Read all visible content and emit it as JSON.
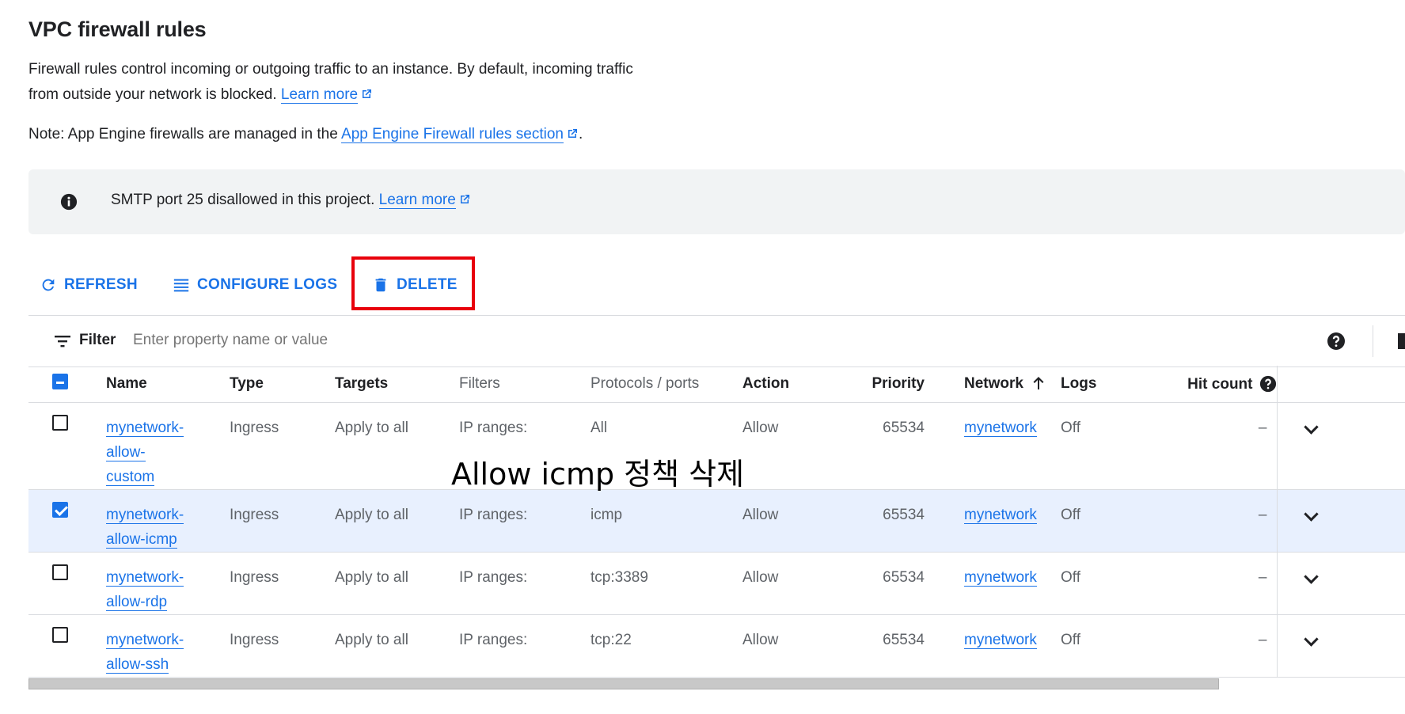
{
  "page": {
    "title": "VPC firewall rules",
    "description": "Firewall rules control incoming or outgoing traffic to an instance. By default, incoming traffic from outside your network is blocked.",
    "learn_more": "Learn more",
    "note_prefix": "Note: App Engine firewalls are managed in the",
    "note_link": "App Engine Firewall rules section",
    "note_suffix": "."
  },
  "banner": {
    "text": "SMTP port 25 disallowed in this project.",
    "link": "Learn more",
    "icon": "info-icon"
  },
  "toolbar": {
    "refresh": "REFRESH",
    "configure_logs": "CONFIGURE LOGS",
    "delete": "DELETE",
    "highlight_color": "#e8000b"
  },
  "filter": {
    "label": "Filter",
    "placeholder": "Enter property name or value"
  },
  "table": {
    "columns": [
      "Name",
      "Type",
      "Targets",
      "Filters",
      "Protocols / ports",
      "Action",
      "Priority",
      "Network",
      "Logs",
      "Hit count"
    ],
    "rows": [
      {
        "checked": false,
        "name_lines": [
          "mynetwork-",
          "allow-",
          "custom"
        ],
        "type": "Ingress",
        "targets": "Apply to all",
        "filters": "IP ranges:",
        "protocols": "All",
        "action": "Allow",
        "priority": "65534",
        "network": "mynetwork",
        "logs": "Off",
        "hit_count": "–"
      },
      {
        "checked": true,
        "name_lines": [
          "mynetwork-",
          "allow-icmp"
        ],
        "type": "Ingress",
        "targets": "Apply to all",
        "filters": "IP ranges:",
        "protocols": "icmp",
        "action": "Allow",
        "priority": "65534",
        "network": "mynetwork",
        "logs": "Off",
        "hit_count": "–"
      },
      {
        "checked": false,
        "name_lines": [
          "mynetwork-",
          "allow-rdp"
        ],
        "type": "Ingress",
        "targets": "Apply to all",
        "filters": "IP ranges:",
        "protocols": "tcp:3389",
        "action": "Allow",
        "priority": "65534",
        "network": "mynetwork",
        "logs": "Off",
        "hit_count": "–"
      },
      {
        "checked": false,
        "name_lines": [
          "mynetwork-",
          "allow-ssh"
        ],
        "type": "Ingress",
        "targets": "Apply to all",
        "filters": "IP ranges:",
        "protocols": "tcp:22",
        "action": "Allow",
        "priority": "65534",
        "network": "mynetwork",
        "logs": "Off",
        "hit_count": "–"
      }
    ]
  },
  "annotation": "Allow icmp 정책 삭제",
  "colors": {
    "link": "#1a73e8",
    "selected_row": "#e8f0fe",
    "banner_bg": "#f1f3f4"
  }
}
